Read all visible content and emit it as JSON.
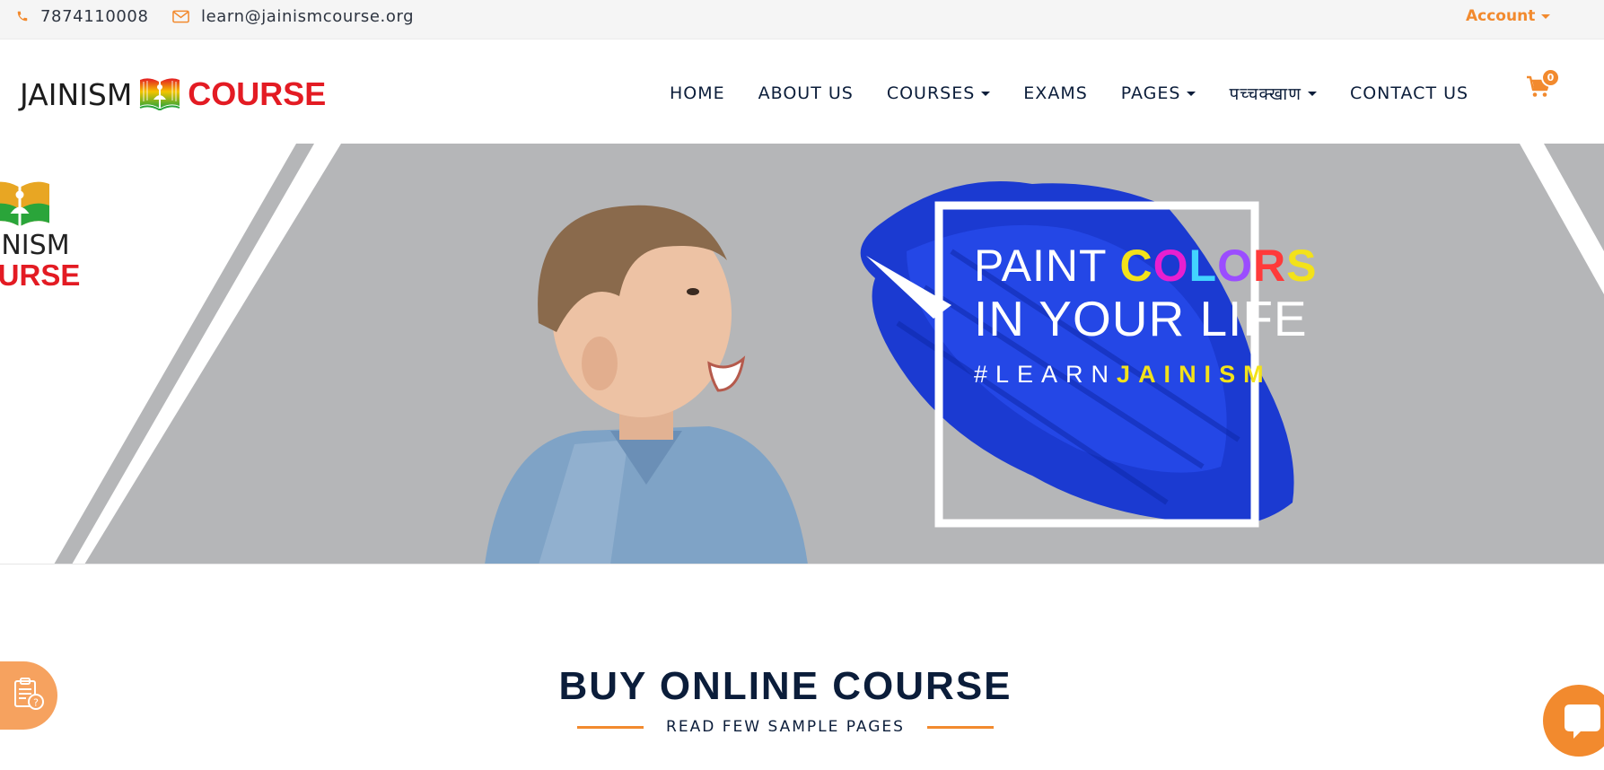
{
  "topbar": {
    "phone": "7874110008",
    "email": "learn@jainismcourse.org",
    "account_label": "Account"
  },
  "header": {
    "logo_word1": "JAINISM",
    "logo_word2": "COURSE",
    "nav": [
      "HOME",
      "ABOUT US",
      "COURSES",
      "EXAMS",
      "PAGES",
      "पच्चक्खाण",
      "CONTACT US"
    ],
    "cart_count": "0"
  },
  "banner": {
    "logo_word1": "AINISM",
    "logo_word2": "OURSE",
    "line1_a": "PAINT ",
    "line1_b": [
      "C",
      "O",
      "L",
      "O",
      "R",
      "S"
    ],
    "line2": "IN YOUR LIFE",
    "line3_a": "#LEARN",
    "line3_b": "JAINISM"
  },
  "section": {
    "title": "BUY ONLINE COURSE",
    "subtitle": "READ FEW SAMPLE PAGES"
  },
  "colors": {
    "accent": "#f28a2e",
    "navy": "#0b1d3a",
    "brand_red": "#e31b23",
    "banner_grey": "#b5b6b8",
    "brush_blue": "#1b3ad1"
  },
  "icons": [
    "phone-icon",
    "envelope-icon",
    "book-logo-icon",
    "shopping-cart-icon",
    "clipboard-question-icon",
    "chat-bubble-icon"
  ]
}
